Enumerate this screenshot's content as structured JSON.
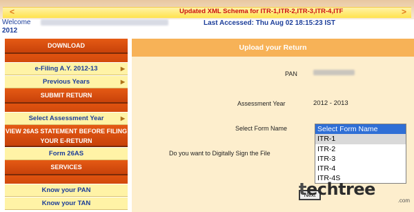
{
  "ticker": {
    "prev_arrow": "<",
    "text": "Updated XML Schema for ITR-1,ITR-2,ITR-3,ITR-4,ITF",
    "next_arrow": ">"
  },
  "welcome": {
    "label": "Welcome",
    "year": "2012",
    "last_accessed": "Last Accessed:  Thu Aug 02 18:15:23 IST"
  },
  "sidebar": {
    "download": "DOWNLOAD",
    "efiling": "e-Filing A.Y. 2012-13",
    "previous_years": "Previous Years",
    "submit_return": "SUBMIT RETURN",
    "select_year": "Select Assessment Year",
    "view_26as": "VIEW 26AS STATEMENT BEFORE FILING YOUR E-RETURN",
    "form_26as": "Form 26AS",
    "services": "SERVICES",
    "know_pan": "Know your PAN",
    "know_tan": "Know your TAN"
  },
  "main": {
    "title": "Upload your Return",
    "pan_label": "PAN",
    "assessment_year_label": "Assessment Year",
    "assessment_year_value": "2012 - 2013",
    "select_form_label": "Select Form Name",
    "digital_sign_label": "Do you want to Digitally Sign the File",
    "next_button": "Next",
    "form_options": [
      "Select Form Name",
      "ITR-1",
      "ITR-2",
      "ITR-3",
      "ITR-4",
      "ITR-4S"
    ],
    "selected_option": "Select Form Name"
  },
  "watermark": {
    "brand_t": "t",
    "brand_rest": "echtree",
    "domain": ".com"
  },
  "colors": {
    "sidebar_orange": "#d44d0e",
    "sidebar_yellow": "#fff3a6",
    "panel_header": "#f7b257",
    "panel_body": "#fdeecd",
    "link_blue": "#1b3d99",
    "ticker_red": "#cc1111",
    "selection_blue": "#2f6fd6"
  }
}
